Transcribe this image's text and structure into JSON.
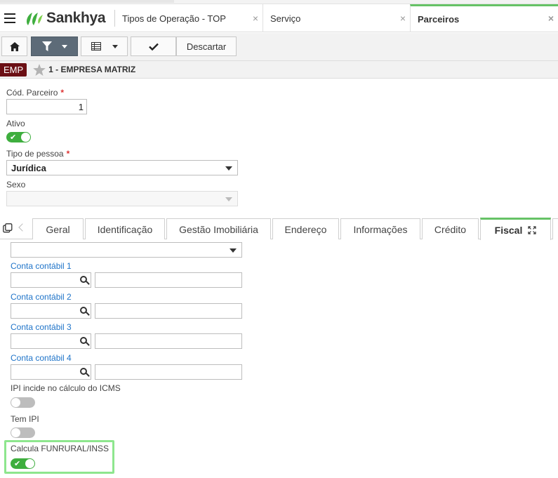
{
  "app": {
    "logo_text": "Sankhya"
  },
  "tabs": [
    {
      "label": "Tipos de Operação - TOP",
      "close": "×"
    },
    {
      "label": "Serviço",
      "close": "×"
    },
    {
      "label": "Parceiros",
      "close": "×",
      "active": true
    }
  ],
  "toolbar": {
    "discard_label": "Descartar"
  },
  "company": {
    "badge": "EMP",
    "title": "1 - EMPRESA MATRIZ"
  },
  "form": {
    "cod_parceiro_label": "Cód. Parceiro",
    "cod_parceiro_value": "1",
    "required_mark": "*",
    "ativo_label": "Ativo",
    "ativo": true,
    "tipo_pessoa_label": "Tipo de pessoa",
    "tipo_pessoa_value": "Jurídica",
    "sexo_label": "Sexo",
    "sexo_value": ""
  },
  "subtabs": [
    "Geral",
    "Identificação",
    "Gestão Imobiliária",
    "Endereço",
    "Informações",
    "Crédito",
    "Fiscal"
  ],
  "fiscal": {
    "conta1_label": "Conta contábil 1",
    "conta2_label": "Conta contábil 2",
    "conta3_label": "Conta contábil 3",
    "conta4_label": "Conta contábil 4",
    "ipi_icms_label": "IPI incide no cálculo do ICMS",
    "ipi_icms": false,
    "tem_ipi_label": "Tem IPI",
    "tem_ipi": false,
    "funrural_label": "Calcula FUNRURAL/INSS",
    "funrural": true
  },
  "colors": {
    "accent": "#66c266",
    "toggle_on": "#3eae3e",
    "link": "#1f74c9",
    "badge": "#6b0f14"
  }
}
